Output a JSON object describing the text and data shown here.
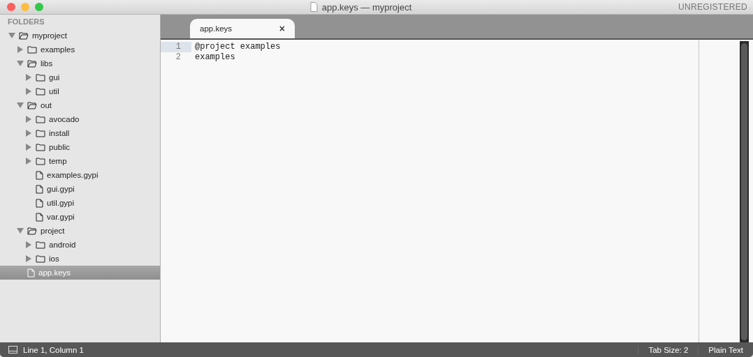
{
  "window": {
    "title": "app.keys — myproject",
    "badge": "UNREGISTERED"
  },
  "sidebar": {
    "header": "FOLDERS",
    "tree": [
      {
        "kind": "folder",
        "label": "myproject",
        "expanded": true,
        "selected": false,
        "children": [
          {
            "kind": "folder",
            "label": "examples",
            "expanded": false,
            "selected": false
          },
          {
            "kind": "folder",
            "label": "libs",
            "expanded": true,
            "selected": false,
            "children": [
              {
                "kind": "folder",
                "label": "gui",
                "expanded": false,
                "selected": false
              },
              {
                "kind": "folder",
                "label": "util",
                "expanded": false,
                "selected": false
              }
            ]
          },
          {
            "kind": "folder",
            "label": "out",
            "expanded": true,
            "selected": false,
            "children": [
              {
                "kind": "folder",
                "label": "avocado",
                "expanded": false,
                "selected": false
              },
              {
                "kind": "folder",
                "label": "install",
                "expanded": false,
                "selected": false
              },
              {
                "kind": "folder",
                "label": "public",
                "expanded": false,
                "selected": false
              },
              {
                "kind": "folder",
                "label": "temp",
                "expanded": false,
                "selected": false
              },
              {
                "kind": "file",
                "label": "examples.gypi",
                "selected": false
              },
              {
                "kind": "file",
                "label": "gui.gypi",
                "selected": false
              },
              {
                "kind": "file",
                "label": "util.gypi",
                "selected": false
              },
              {
                "kind": "file",
                "label": "var.gypi",
                "selected": false
              }
            ]
          },
          {
            "kind": "folder",
            "label": "project",
            "expanded": true,
            "selected": false,
            "children": [
              {
                "kind": "folder",
                "label": "android",
                "expanded": false,
                "selected": false
              },
              {
                "kind": "folder",
                "label": "ios",
                "expanded": false,
                "selected": false
              }
            ]
          },
          {
            "kind": "file",
            "label": "app.keys",
            "selected": true
          }
        ]
      }
    ]
  },
  "tabs": [
    {
      "label": "app.keys",
      "selected": true,
      "close": "×"
    }
  ],
  "editor": {
    "lines": [
      {
        "number": "1",
        "text": "@project examples",
        "current": true
      },
      {
        "number": "2",
        "text": "examples",
        "current": false
      }
    ]
  },
  "status_bar": {
    "position": "Line 1, Column 1",
    "tab_size": "Tab Size: 2",
    "syntax": "Plain Text"
  }
}
